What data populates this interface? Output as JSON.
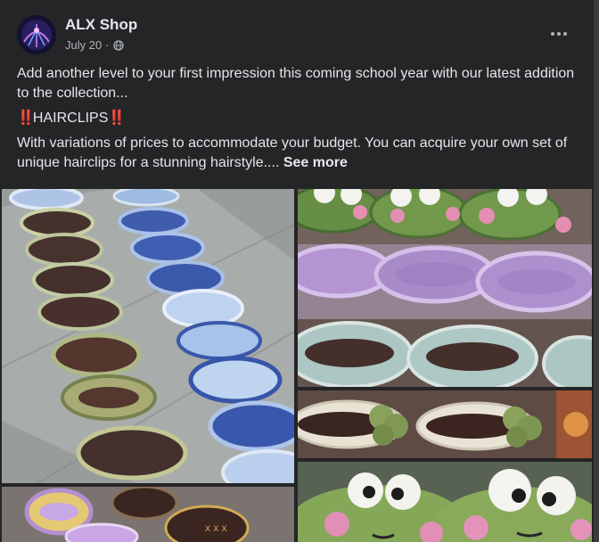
{
  "post": {
    "author": "ALX Shop",
    "date": "July 20",
    "separator": "·",
    "audience_icon": "globe-icon",
    "menu_icon": "more-horizontal-icon",
    "paragraph1": "Add another level to your first impression this coming school year with our latest addition to the collection...",
    "headline_marks": "‼️",
    "headline": "HAIRCLIPS",
    "paragraph3": "With variations of prices to accommodate your budget. You can acquire your own set of unique hairclips for a stunning hairstyle.... ",
    "see_more": "See more"
  },
  "colors": {
    "background": "#18191a",
    "card": "#242526",
    "text_primary": "#e4e6eb",
    "text_secondary": "#b0b3b8"
  }
}
